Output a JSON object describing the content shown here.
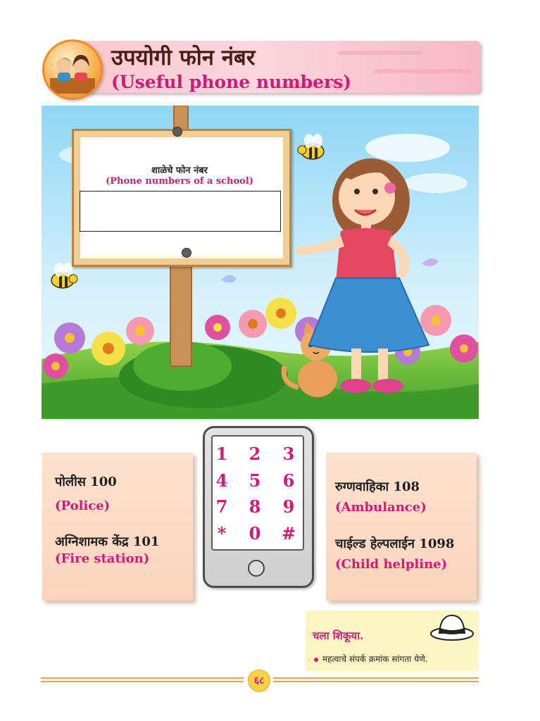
{
  "header": {
    "title_mr": "उपयोगी फोन नंबर",
    "title_en": "(Useful phone numbers)"
  },
  "signboard": {
    "heading_mr": "शाळेचे फोन नंबर",
    "heading_en": "(Phone numbers of a school)",
    "field_value": ""
  },
  "left_card": {
    "police_mr": "पोलीस 100",
    "police_en": "(Police)",
    "fire_mr": "अग्निशामक केंद्र 101",
    "fire_en": "(Fire station)"
  },
  "right_card": {
    "ambulance_mr": "रुग्णवाहिका 108",
    "ambulance_en": "(Ambulance)",
    "child_mr": "चाईल्ड हेल्पलाईन  1098",
    "child_en": "(Child helpline)"
  },
  "keypad": {
    "keys": [
      "1",
      "2",
      "3",
      "4",
      "5",
      "6",
      "7",
      "8",
      "9",
      "*",
      "0",
      "#"
    ]
  },
  "learn": {
    "title": "चला शिकूया.",
    "item": "महत्वाचे संपर्क क्रमांक सांगता येणे."
  },
  "footer": {
    "page_number": "६८"
  },
  "colors": {
    "accent_pink": "#d6177a",
    "card_peach": "#fbd4bb",
    "header_pink": "#f9c7cf",
    "learn_yellow": "#fbf5c4"
  }
}
